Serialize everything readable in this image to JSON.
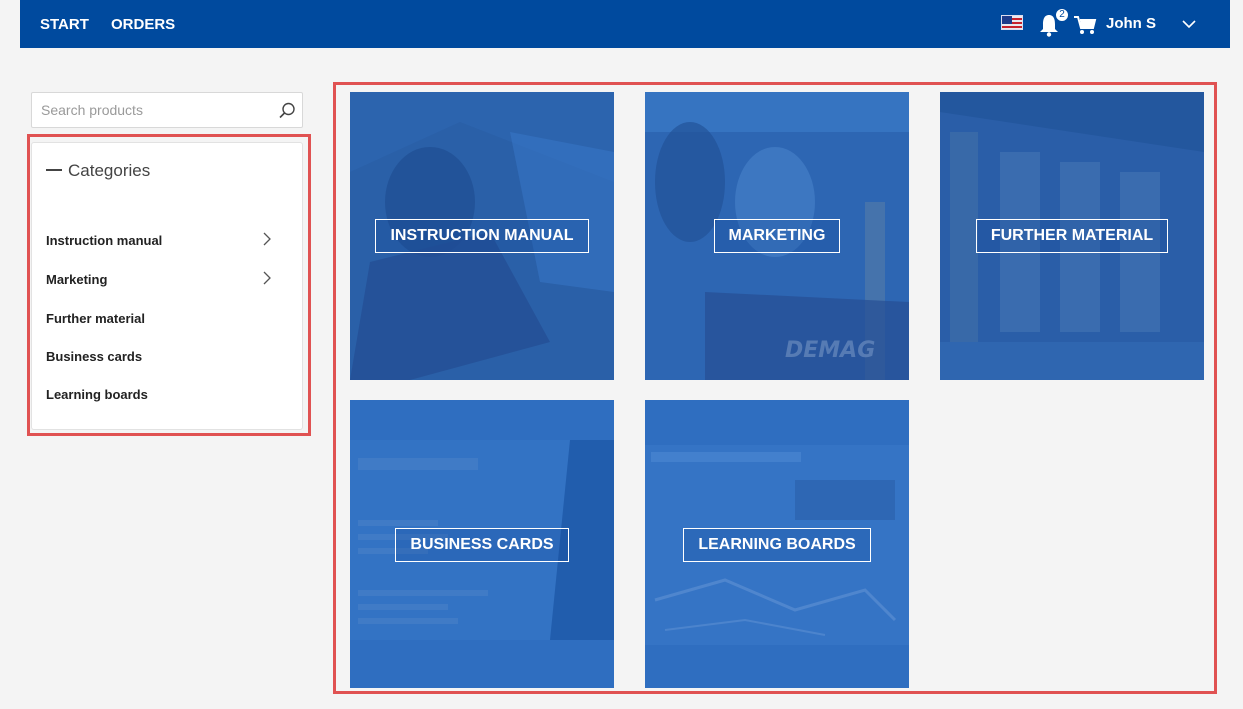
{
  "topbar": {
    "nav": [
      {
        "label": "START"
      },
      {
        "label": "ORDERS"
      }
    ],
    "language_icon": "us-flag-icon",
    "notifications": {
      "icon": "bell-icon",
      "count": "2"
    },
    "cart_icon": "cart-icon",
    "user": {
      "name": "John S",
      "icon": "chevron-down-icon"
    }
  },
  "search": {
    "placeholder": "Search products",
    "icon": "search-icon"
  },
  "categories": {
    "title": "Categories",
    "collapse_icon": "minus-icon",
    "items": [
      {
        "label": "Instruction manual",
        "has_children": true
      },
      {
        "label": "Marketing",
        "has_children": true
      },
      {
        "label": "Further material",
        "has_children": false
      },
      {
        "label": "Business cards",
        "has_children": false
      },
      {
        "label": "Learning boards",
        "has_children": false
      }
    ]
  },
  "tiles": [
    {
      "label": "INSTRUCTION MANUAL"
    },
    {
      "label": "MARKETING"
    },
    {
      "label": "FURTHER MATERIAL"
    },
    {
      "label": "BUSINESS CARDS"
    },
    {
      "label": "LEARNING BOARDS"
    }
  ],
  "colors": {
    "brand_blue": "#004a9e",
    "tile_blue": "#2f6fbf",
    "highlight_red": "#e05252"
  }
}
